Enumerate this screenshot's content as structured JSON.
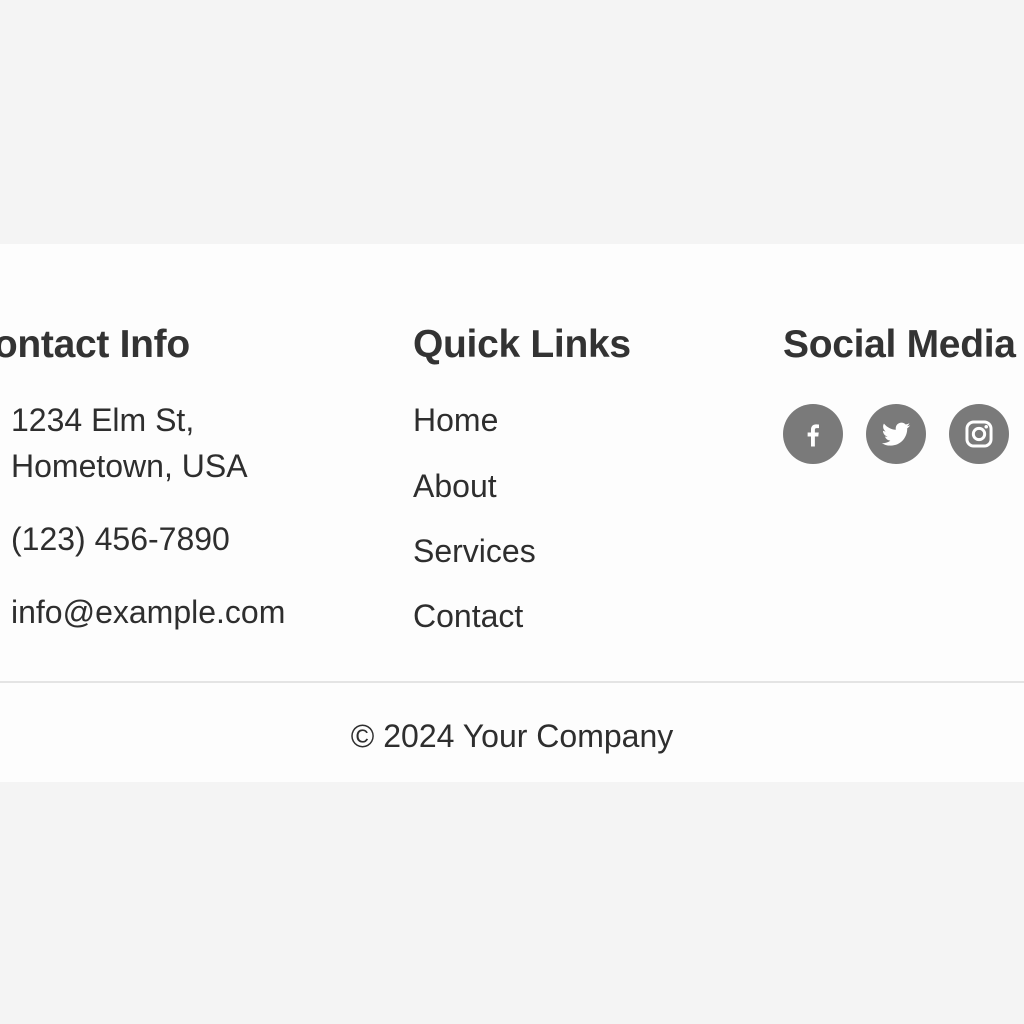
{
  "contact": {
    "heading": "Contact Info",
    "address_line1": "1234 Elm St,",
    "address_line2": "Hometown, USA",
    "phone": "(123) 456-7890",
    "email": "info@example.com"
  },
  "quick_links": {
    "heading": "Quick Links",
    "items": [
      {
        "label": "Home"
      },
      {
        "label": "About"
      },
      {
        "label": "Services"
      },
      {
        "label": "Contact"
      }
    ]
  },
  "social": {
    "heading": "Social Media",
    "icons": [
      "facebook-icon",
      "twitter-icon",
      "instagram-icon"
    ]
  },
  "copyright": "© 2024 Your Company",
  "colors": {
    "page_background": "#f4f4f4",
    "footer_background": "#fdfdfd",
    "text": "#2e2e2e",
    "social_icon_background": "#7a7a7a",
    "divider": "#e4e4e4"
  }
}
